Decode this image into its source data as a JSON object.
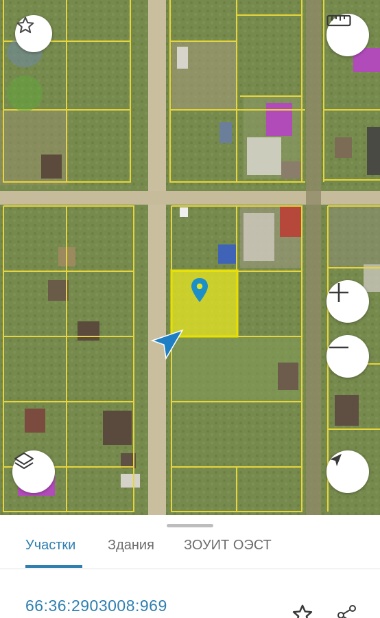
{
  "map": {
    "colors": {
      "boundary": "#e6d53c",
      "selected_fill": "#e2e324",
      "selected_stroke": "#e8e000",
      "road": "#cdbf9c",
      "building_highlight": "#b14bb9",
      "marker": "#1c8fc9",
      "accent": "#2f7fb0"
    },
    "map_controls": {
      "favorite_icon": "star-outline-icon",
      "ruler_icon": "ruler-icon",
      "zoom_in_icon": "plus-icon",
      "zoom_out_icon": "minus-icon",
      "layers_icon": "layers-icon",
      "my_location_icon": "navigation-arrow-icon"
    }
  },
  "panel": {
    "tabs": [
      {
        "label": "Участки",
        "active": true
      },
      {
        "label": "Здания",
        "active": false
      },
      {
        "label": "ЗОУИТ ОЭСТ",
        "active": false
      }
    ],
    "parcel": {
      "cadastral_number": "66:36:2903008:969",
      "favorite_icon": "star-outline-icon",
      "share_icon": "share-icon"
    }
  }
}
